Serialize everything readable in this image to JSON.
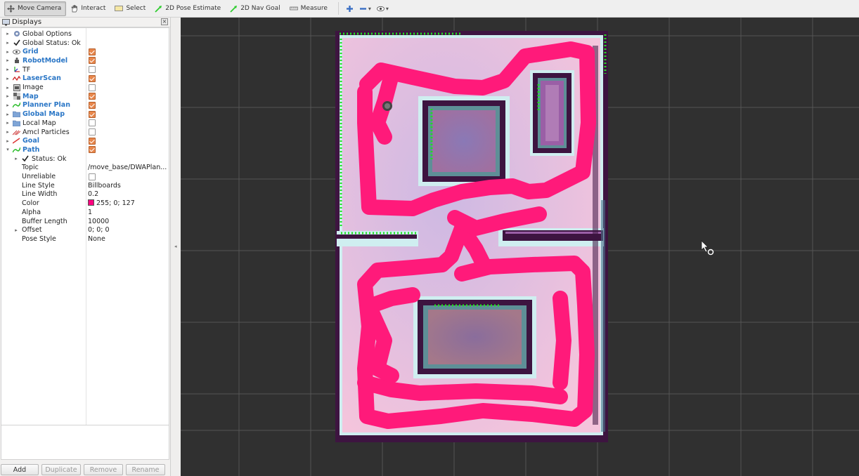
{
  "toolbar": {
    "tools": [
      {
        "label": "Move Camera",
        "icon": "move-camera-icon",
        "active": true
      },
      {
        "label": "Interact",
        "icon": "hand-icon",
        "active": false
      },
      {
        "label": "Select",
        "icon": "select-icon",
        "active": false
      },
      {
        "label": "2D Pose Estimate",
        "icon": "green-arrow-icon",
        "active": false
      },
      {
        "label": "2D Nav Goal",
        "icon": "green-arrow-icon",
        "active": false
      },
      {
        "label": "Measure",
        "icon": "ruler-icon",
        "active": false
      }
    ],
    "extra_icons": [
      "plus-icon",
      "minus-icon",
      "eye-icon"
    ]
  },
  "displays": {
    "title": "Displays",
    "items": [
      {
        "label": "Global Options",
        "icon": "gear-icon",
        "bold": false,
        "checkbox": null,
        "depth": 0
      },
      {
        "label": "Global Status: Ok",
        "icon": "check-icon",
        "bold": false,
        "checkbox": null,
        "depth": 0
      },
      {
        "label": "Grid",
        "icon": "grid-icon",
        "bold": true,
        "checkbox": true,
        "depth": 0
      },
      {
        "label": "RobotModel",
        "icon": "robot-icon",
        "bold": true,
        "checkbox": true,
        "depth": 0
      },
      {
        "label": "TF",
        "icon": "tf-icon",
        "bold": false,
        "checkbox": false,
        "depth": 0
      },
      {
        "label": "LaserScan",
        "icon": "laserscan-icon",
        "bold": true,
        "checkbox": true,
        "depth": 0
      },
      {
        "label": "Image",
        "icon": "image-icon",
        "bold": false,
        "checkbox": false,
        "depth": 0
      },
      {
        "label": "Map",
        "icon": "map-icon",
        "bold": true,
        "checkbox": true,
        "depth": 0
      },
      {
        "label": "Planner Plan",
        "icon": "path-icon",
        "bold": true,
        "checkbox": true,
        "depth": 0
      },
      {
        "label": "Global Map",
        "icon": "folder-icon",
        "bold": true,
        "checkbox": true,
        "depth": 0
      },
      {
        "label": "Local Map",
        "icon": "folder-icon",
        "bold": false,
        "checkbox": false,
        "depth": 0
      },
      {
        "label": "Amcl Particles",
        "icon": "particles-icon",
        "bold": false,
        "checkbox": false,
        "depth": 0
      },
      {
        "label": "Goal",
        "icon": "goal-icon",
        "bold": true,
        "checkbox": true,
        "depth": 0
      },
      {
        "label": "Path",
        "icon": "path-icon",
        "bold": true,
        "checkbox": true,
        "depth": 0,
        "expanded": true
      }
    ],
    "path_properties": [
      {
        "label": "Status: Ok",
        "value": "",
        "type": "status"
      },
      {
        "label": "Topic",
        "value": "/move_base/DWAPlan...",
        "type": "text"
      },
      {
        "label": "Unreliable",
        "value": "",
        "type": "checkbox",
        "checked": false
      },
      {
        "label": "Line Style",
        "value": "Billboards",
        "type": "text"
      },
      {
        "label": "Line Width",
        "value": "0.2",
        "type": "text"
      },
      {
        "label": "Color",
        "value": "255; 0; 127",
        "type": "color",
        "color": "#ff007f"
      },
      {
        "label": "Alpha",
        "value": "1",
        "type": "text"
      },
      {
        "label": "Buffer Length",
        "value": "10000",
        "type": "text"
      },
      {
        "label": "Offset",
        "value": "0; 0; 0",
        "type": "expand"
      },
      {
        "label": "Pose Style",
        "value": "None",
        "type": "text"
      }
    ],
    "buttons": [
      "Add",
      "Duplicate",
      "Remove",
      "Rename"
    ]
  },
  "colors": {
    "viewport_bg": "#303030",
    "grid_line": "#555555",
    "path": "#ff1a7a",
    "wall": "#3d1440",
    "free": "#f3bed6",
    "laser": "#22dd22"
  }
}
